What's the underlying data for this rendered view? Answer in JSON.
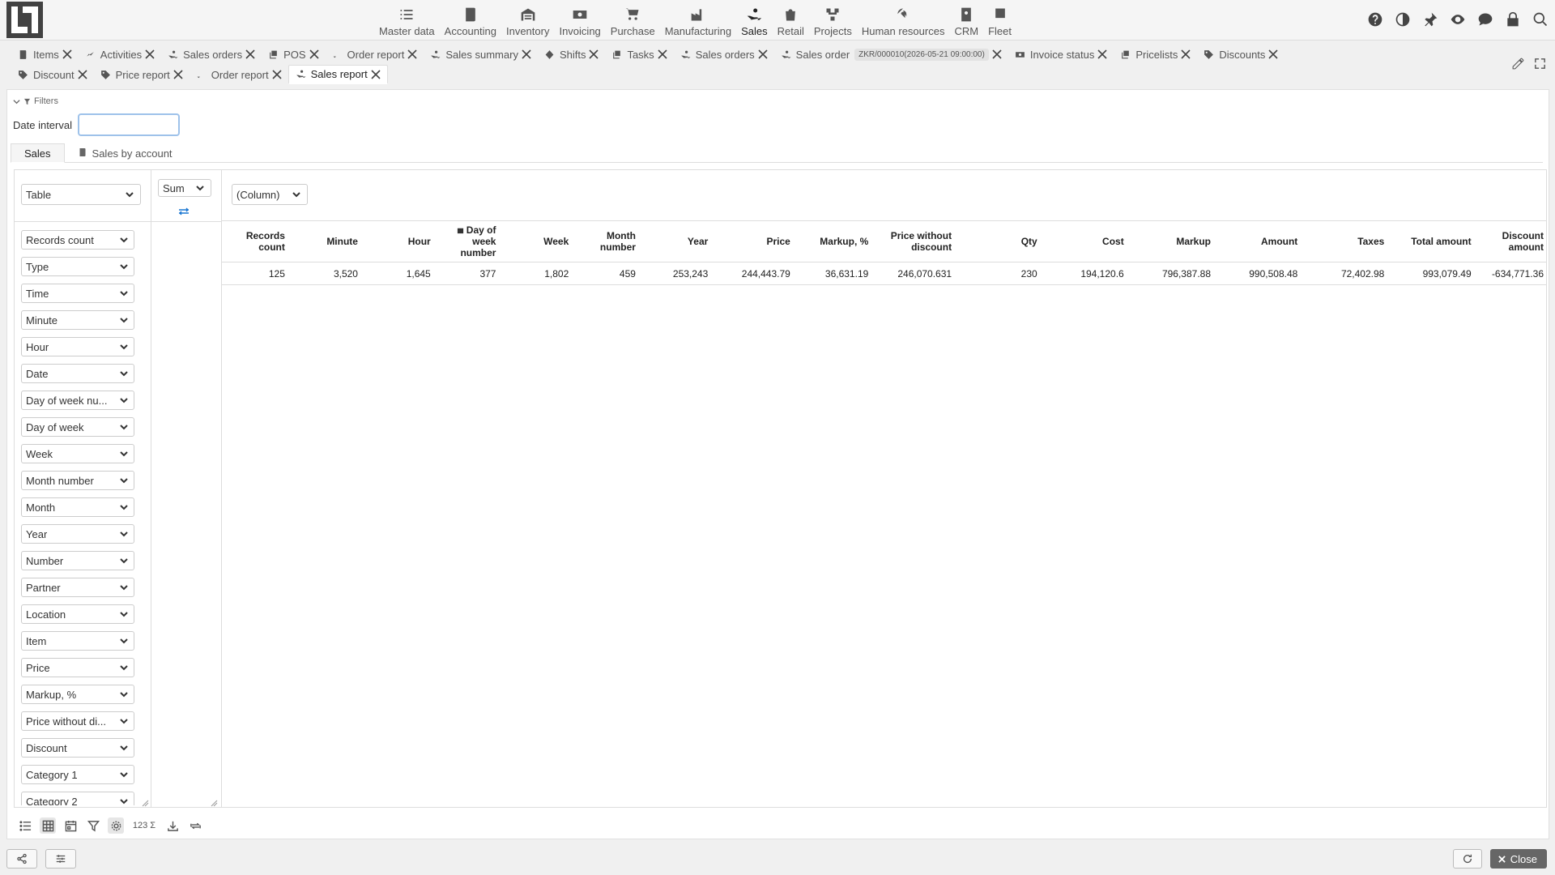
{
  "modules": [
    {
      "label": "Master data",
      "icon": "list-check-icon"
    },
    {
      "label": "Accounting",
      "icon": "ledger-icon"
    },
    {
      "label": "Inventory",
      "icon": "warehouse-icon"
    },
    {
      "label": "Invoicing",
      "icon": "money-icon"
    },
    {
      "label": "Purchase",
      "icon": "cart-icon"
    },
    {
      "label": "Manufacturing",
      "icon": "factory-icon"
    },
    {
      "label": "Sales",
      "icon": "hand-coin-icon",
      "active": true
    },
    {
      "label": "Retail",
      "icon": "bag-icon"
    },
    {
      "label": "Projects",
      "icon": "diagram-icon"
    },
    {
      "label": "Human resources",
      "icon": "fingerprint-icon"
    },
    {
      "label": "CRM",
      "icon": "contact-icon"
    },
    {
      "label": "Fleet",
      "icon": "bus-icon"
    }
  ],
  "top_icons": [
    "help-icon",
    "contrast-icon",
    "pin-icon",
    "eye-icon",
    "chat-icon",
    "lock-icon",
    "search-icon"
  ],
  "tabs_row1": [
    {
      "label": "Items",
      "icon": "ledger-icon"
    },
    {
      "label": "Activities",
      "icon": "chart-line-icon"
    },
    {
      "label": "Sales orders",
      "icon": "hand-coin-icon"
    },
    {
      "label": "POS",
      "icon": "copy-icon"
    },
    {
      "label": "Order report",
      "icon": "sort-icon"
    },
    {
      "label": "Sales summary",
      "icon": "hand-coin-icon"
    },
    {
      "label": "Shifts",
      "icon": "diamond-icon"
    },
    {
      "label": "Tasks",
      "icon": "copy-icon"
    },
    {
      "label": "Sales orders",
      "icon": "hand-coin-icon"
    },
    {
      "label": "Sales order",
      "icon": "hand-coin-icon",
      "badge": "ZKR/000010(2026-05-21 09:00:00)"
    },
    {
      "label": "Invoice status",
      "icon": "money-icon"
    },
    {
      "label": "Pricelists",
      "icon": "copy-icon"
    },
    {
      "label": "Discounts",
      "icon": "tag-icon"
    }
  ],
  "tabs_row2": [
    {
      "label": "Discount",
      "icon": "tag-icon"
    },
    {
      "label": "Price report",
      "icon": "tag-icon"
    },
    {
      "label": "Order report",
      "icon": "sort-icon"
    },
    {
      "label": "Sales report",
      "icon": "hand-coin-icon",
      "active": true
    }
  ],
  "filters": {
    "toggle_label": "Filters",
    "date_interval_label": "Date interval",
    "date_interval_value": ""
  },
  "subtabs": [
    {
      "label": "Sales",
      "active": true
    },
    {
      "label": "Sales by account",
      "icon": "ledger-icon"
    }
  ],
  "pivot": {
    "renderer": "Table",
    "aggregator": "Sum",
    "column_field": "(Column)",
    "attributes": [
      "Records count",
      "Type",
      "Time",
      "Minute",
      "Hour",
      "Date",
      "Day of week nu...",
      "Day of week",
      "Week",
      "Month number",
      "Month",
      "Year",
      "Number",
      "Partner",
      "Location",
      "Item",
      "Price",
      "Markup, %",
      "Price without di...",
      "Discount",
      "Category 1",
      "Category 2"
    ],
    "columns": [
      {
        "label": "Records count"
      },
      {
        "label": "Minute"
      },
      {
        "label": "Hour"
      },
      {
        "label": "Day of week number",
        "icon": "calendar-icon"
      },
      {
        "label": "Week"
      },
      {
        "label": "Month number"
      },
      {
        "label": "Year"
      },
      {
        "label": "Price"
      },
      {
        "label": "Markup, %"
      },
      {
        "label": "Price without discount"
      },
      {
        "label": "Qty"
      },
      {
        "label": "Cost"
      },
      {
        "label": "Markup"
      },
      {
        "label": "Amount"
      },
      {
        "label": "Taxes"
      },
      {
        "label": "Total amount"
      },
      {
        "label": "Discount amount"
      }
    ],
    "values": [
      "125",
      "3,520",
      "1,645",
      "377",
      "1,802",
      "459",
      "253,243",
      "244,443.79",
      "36,631.19",
      "246,070.631",
      "230",
      "194,120.6",
      "796,387.88",
      "990,508.48",
      "72,402.98",
      "993,079.49",
      "-634,771.36"
    ]
  },
  "toolbar": {
    "numsum_label": "123 Σ"
  },
  "footer": {
    "close_label": "Close"
  }
}
